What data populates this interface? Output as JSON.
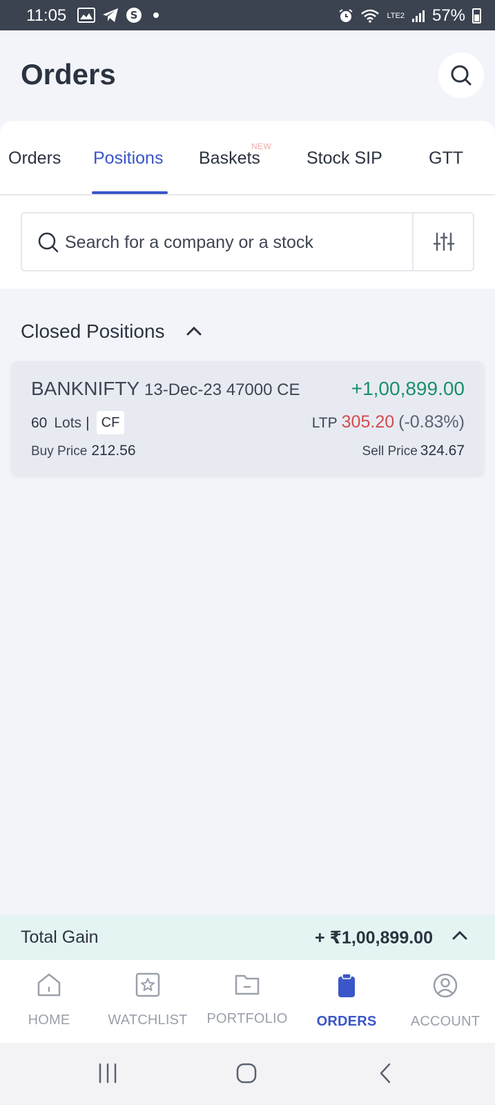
{
  "status_bar": {
    "time": "11:05",
    "network": "LTE2",
    "battery": "57%"
  },
  "header": {
    "title": "Orders"
  },
  "tabs": [
    {
      "label": "Orders"
    },
    {
      "label": "Positions",
      "active": true
    },
    {
      "label": "Baskets",
      "badge": "NEW"
    },
    {
      "label": "Stock SIP"
    },
    {
      "label": "GTT"
    }
  ],
  "search": {
    "placeholder": "Search for a company or a stock"
  },
  "section": {
    "title": "Closed Positions"
  },
  "position": {
    "symbol": "BANKNIFTY",
    "contract": "13-Dec-23 47000 CE",
    "pnl": "+1,00,899.00",
    "lots": "60",
    "lots_unit": "Lots",
    "separator": "|",
    "product": "CF",
    "ltp_label": "LTP",
    "ltp": "305.20",
    "ltp_change": "(-0.83%)",
    "buy_label": "Buy Price",
    "buy_price": "212.56",
    "sell_label": "Sell Price",
    "sell_price": "324.67"
  },
  "total": {
    "label": "Total Gain",
    "value": "+ ₹1,00,899.00"
  },
  "bottom_nav": [
    {
      "label": "HOME",
      "icon": "home-icon"
    },
    {
      "label": "WATCHLIST",
      "icon": "watchlist-icon"
    },
    {
      "label": "PORTFOLIO",
      "icon": "portfolio-icon"
    },
    {
      "label": "ORDERS",
      "icon": "orders-icon",
      "active": true
    },
    {
      "label": "ACCOUNT",
      "icon": "account-icon"
    }
  ],
  "colors": {
    "accent": "#3a56c9",
    "gain": "#1a8f6a",
    "loss": "#d34b4b",
    "total_bg": "#e4f4f2"
  }
}
